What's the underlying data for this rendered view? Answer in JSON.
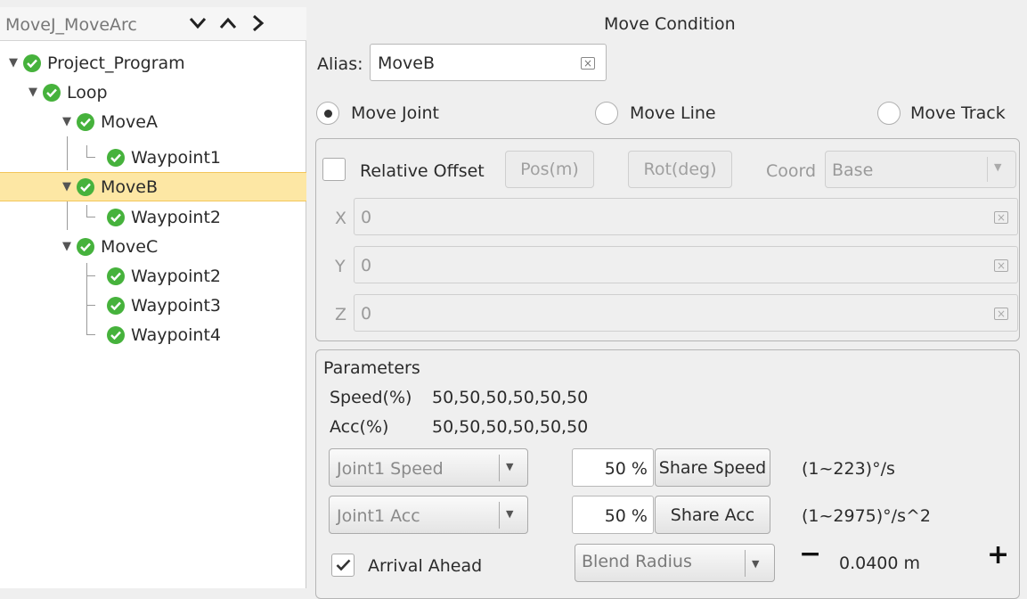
{
  "tree": {
    "title": "MoveJ_MoveArc",
    "nav_icons": [
      "chevron-down-icon",
      "chevron-up-icon",
      "chevron-right-icon"
    ],
    "items": [
      {
        "label": "Project_Program"
      },
      {
        "label": "Loop"
      },
      {
        "label": "MoveA"
      },
      {
        "label": "Waypoint1"
      },
      {
        "label": "MoveB",
        "selected": true
      },
      {
        "label": "Waypoint2"
      },
      {
        "label": "MoveC"
      },
      {
        "label": "Waypoint2"
      },
      {
        "label": "Waypoint3"
      },
      {
        "label": "Waypoint4"
      }
    ]
  },
  "move_condition": {
    "title": "Move Condition",
    "alias_label": "Alias:",
    "alias_value": "MoveB",
    "move_types": [
      {
        "label": "Move Joint",
        "checked": true
      },
      {
        "label": "Move Line",
        "checked": false
      },
      {
        "label": "Move Track",
        "checked": false
      }
    ]
  },
  "offset": {
    "checkbox_label": "Relative Offset",
    "pos_button": "Pos(m)",
    "rot_button": "Rot(deg)",
    "coord_label": "Coord",
    "coord_value": "Base",
    "fields": [
      {
        "axis": "X",
        "value": "0"
      },
      {
        "axis": "Y",
        "value": "0"
      },
      {
        "axis": "Z",
        "value": "0"
      }
    ]
  },
  "parameters": {
    "title": "Parameters",
    "speed_label": "Speed(%)",
    "speed_value": "50,50,50,50,50,50",
    "acc_label": "Acc(%)",
    "acc_value": "50,50,50,50,50,50",
    "joint_speed_select": "Joint1 Speed",
    "joint_speed_value": "50 %",
    "share_speed_button": "Share Speed",
    "speed_range": "(1~223)°/s",
    "joint_acc_select": "Joint1 Acc",
    "joint_acc_value": "50 %",
    "share_acc_button": "Share Acc",
    "acc_range": "(1~2975)°/s^2",
    "arrival_ahead_label": "Arrival Ahead",
    "arrival_ahead_checked": true,
    "blend_select": "Blend Radius",
    "blend_value": "0.0400 m",
    "minus_label": "−",
    "plus_label": "+"
  },
  "colors": {
    "selected_row": "#fde7a4",
    "check_green": "#46b23c"
  }
}
